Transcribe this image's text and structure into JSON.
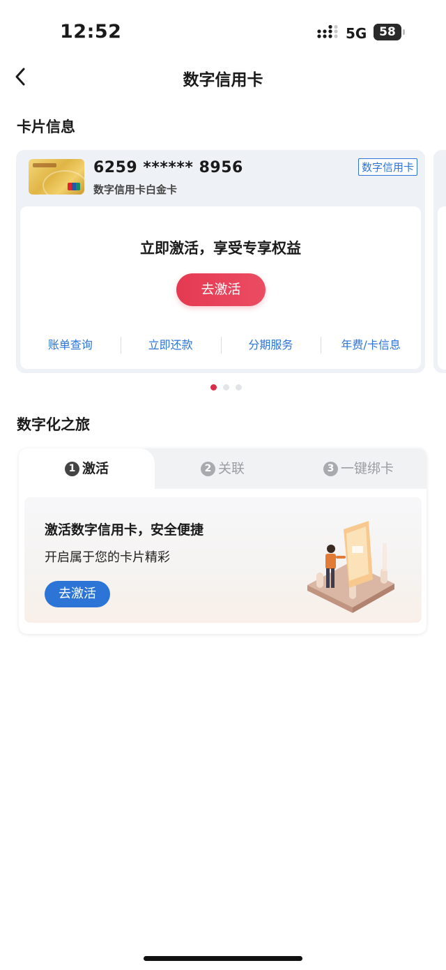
{
  "status_bar": {
    "time": "12:52",
    "network": "5G",
    "battery": "58",
    "battery_level": 0.58
  },
  "nav": {
    "title": "数字信用卡",
    "back_icon": "chevron-left-icon"
  },
  "card_section": {
    "title": "卡片信息",
    "card": {
      "number": "6259 ****** 8956",
      "type": "数字信用卡白金卡",
      "badge": "数字信用卡",
      "headline": "立即激活，享受专享权益",
      "activate_label": "去激活",
      "actions": [
        "账单查询",
        "立即还款",
        "分期服务",
        "年费/卡信息"
      ]
    },
    "carousel": {
      "count": 3,
      "active_index": 0
    }
  },
  "journey_section": {
    "title": "数字化之旅",
    "tabs": [
      {
        "number": "1",
        "label": "激活"
      },
      {
        "number": "2",
        "label": "关联"
      },
      {
        "number": "3",
        "label": "一键绑卡"
      }
    ],
    "active_tab": 0,
    "content": {
      "title": "激活数字信用卡，安全便捷",
      "subtitle": "开启属于您的卡片精彩",
      "button_label": "去激活"
    }
  },
  "colors": {
    "primary_blue": "#2c74d6",
    "accent_red": "#e43a52",
    "background": "#ffffff",
    "panel_bg": "#eef1f5"
  }
}
